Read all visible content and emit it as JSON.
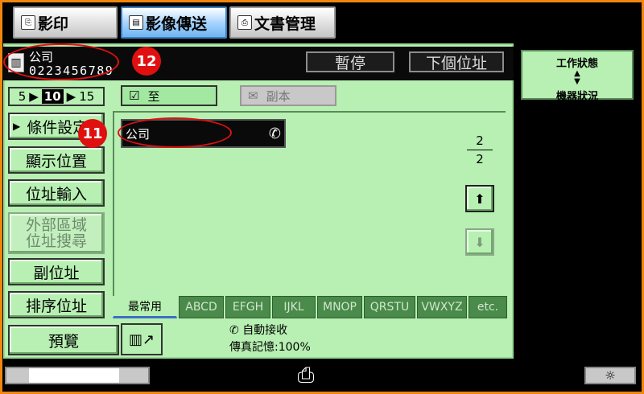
{
  "tabs": [
    {
      "label": "影印",
      "icon": "copy-icon"
    },
    {
      "label": "影像傳送",
      "icon": "image-send-icon",
      "active": true
    },
    {
      "label": "文書管理",
      "icon": "document-filing-icon"
    }
  ],
  "header": {
    "destination_name": "公司",
    "destination_number": "0223456789",
    "pause_label": "暫停",
    "next_address_label": "下個位址"
  },
  "status_panel": {
    "line1": "工作狀態",
    "line2": "機器狀況"
  },
  "pager": {
    "prev": "5",
    "current": "10",
    "next": "15"
  },
  "left_buttons": [
    {
      "label": "條件設定"
    },
    {
      "label": "顯示位置"
    },
    {
      "label": "位址輸入"
    },
    {
      "label_line1": "外部區域",
      "label_line2": "位址搜尋",
      "disabled": true
    },
    {
      "label": "副位址"
    },
    {
      "label": "排序位址"
    }
  ],
  "to_button": "至",
  "cc_button": "副本",
  "address_entry": {
    "name": "公司",
    "icon": "phone-icon"
  },
  "page_indicator": {
    "current": "2",
    "total": "2"
  },
  "index_tabs": [
    "最常用",
    "ABCD",
    "EFGH",
    "IJKL",
    "MNOP",
    "QRSTU",
    "VWXYZ",
    "etc."
  ],
  "preview_label": "預覽",
  "auto_receive": "自動接收",
  "fax_memory": "傳真記憶:100%",
  "callouts": [
    "12",
    "11"
  ],
  "colors": {
    "panel": "#b7f0b2",
    "frame": "#f0860e",
    "callout": "#e01010",
    "active_tab": "#6fb4f0"
  }
}
